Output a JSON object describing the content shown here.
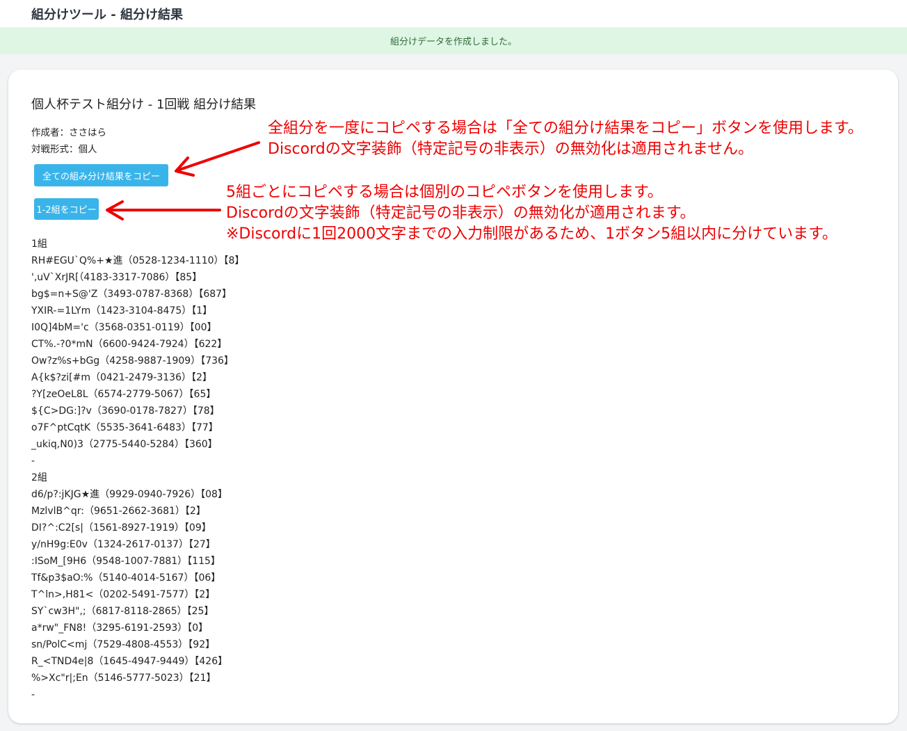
{
  "app": {
    "title": "組分けツール - 組分け結果"
  },
  "flash": {
    "message": "組分けデータを作成しました。"
  },
  "page": {
    "title": "個人杯テスト組分け - 1回戦 組分け結果",
    "creator": "作成者：ささはら",
    "format": "対戦形式：個人"
  },
  "buttons": {
    "copy_all": "全ての組み分け結果をコピー",
    "copy_1_2": "1-2組をコピー"
  },
  "annotations": {
    "note1": [
      "全組分を一度にコピペする場合は「全ての組分け結果をコピー」ボタンを使用します。",
      "Discordの文字装飾（特定記号の非表示）の無効化は適用されません。"
    ],
    "note2": [
      "5組ごとにコピペする場合は個別のコピペボタンを使用します。",
      "Discordの文字装飾（特定記号の非表示）の無効化が適用されます。",
      "※Discordに1回2000文字までの入力制限があるため、1ボタン5組以内に分けています。"
    ],
    "arrow_color": "#ee0000"
  },
  "groups": [
    {
      "name": "1組",
      "players": [
        "RH#EGU`Q%+★進（0528-1234-1110）【8】",
        "',uV`XrJR[（4183-3317-7086）【85】",
        "bg$=n+S@'Z（3493-0787-8368）【687】",
        "YXIR-=1LYm（1423-3104-8475）【1】",
        "I0Q]4bM='c（3568-0351-0119）【00】",
        "CT%.-?0*mN（6600-9424-7924）【622】",
        "Ow?z%s+bGg（4258-9887-1909）【736】",
        "A{k$?zi[#m（0421-2479-3136）【2】",
        "?Y[zeOeL8L（6574-2779-5067）【65】",
        "${C>DG:]?v（3690-0178-7827）【78】",
        "o7F^ptCqtK（5535-3641-6483）【77】",
        "_ukiq,N0)3（2775-5440-5284）【360】"
      ],
      "end": "-"
    },
    {
      "name": "2組",
      "players": [
        "d6/p?:jKJG★進（9929-0940-7926）【08】",
        "MzlvlB^qr:（9651-2662-3681）【2】",
        "DI?^:C2[s|（1561-8927-1919）【09】",
        "y/nH9g:E0v（1324-2617-0137）【27】",
        ":ISoM_[9H6（9548-1007-7881）【115】",
        "Tf&p3$aO:%（5140-4014-5167）【06】",
        "T^ln>,H81<（0202-5491-7577）【2】",
        "SY`cw3H\",;（6817-8118-2865）【25】",
        "a*rw\"_FN8!（3295-6191-2593）【0】",
        "sn/PolC<mj（7529-4808-4553）【92】",
        "R_<TND4e|8（1645-4947-9449）【426】",
        "%>Xc\"r|;En（5146-5777-5023）【21】"
      ],
      "end": "-"
    }
  ]
}
